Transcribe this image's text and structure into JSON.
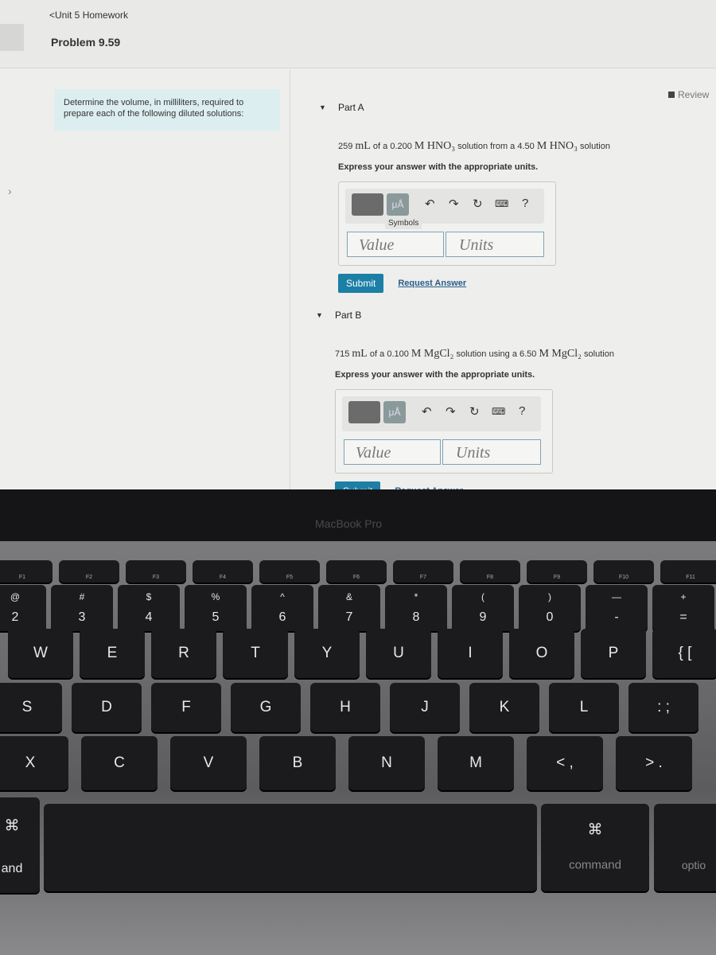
{
  "header": {
    "breadcrumb": "<Unit 5 Homework",
    "problem_title": "Problem 9.59"
  },
  "prompt": "Determine the volume, in milliliters, required to prepare each of the following diluted solutions:",
  "review_label": "Review",
  "parts": [
    {
      "title": "Part A",
      "q_pre": "259 ",
      "q_mL": "mL",
      "q_mid": " of a 0.200 ",
      "q_M1": "M HNO₃",
      "q_mid2": " solution from a 4.50 ",
      "q_M2": "M HNO₃",
      "q_post": " solution",
      "instruction": "Express your answer with the appropriate units.",
      "tooltip": "Symbols",
      "value_placeholder": "Value",
      "units_placeholder": "Units",
      "submit": "Submit",
      "request": "Request Answer",
      "symbols_label": "μÅ"
    },
    {
      "title": "Part B",
      "q_pre": "715 ",
      "q_mL": "mL",
      "q_mid": " of a 0.100 ",
      "q_M1": "M MgCl₂",
      "q_mid2": " solution using a 6.50 ",
      "q_M2": "M MgCl₂",
      "q_post": " solution",
      "instruction": "Express your answer with the appropriate units.",
      "value_placeholder": "Value",
      "units_placeholder": "Units",
      "submit": "Submit",
      "request": "Request Answer",
      "symbols_label": "μÅ"
    }
  ],
  "toolbar_icons": [
    "templates-icon",
    "symbols-icon",
    "undo-icon",
    "redo-icon",
    "reset-icon",
    "keyboard-icon",
    "help-icon"
  ],
  "help_glyph": "?",
  "laptop_brand": "MacBook Pro",
  "keyboard": {
    "fn": [
      "F1",
      "F2",
      "F3",
      "F4",
      "F5",
      "F6",
      "F7",
      "F8",
      "F9",
      "F10",
      "F11"
    ],
    "num": [
      [
        "@",
        "2"
      ],
      [
        "#",
        "3"
      ],
      [
        "$",
        "4"
      ],
      [
        "%",
        "5"
      ],
      [
        "^",
        "6"
      ],
      [
        "&",
        "7"
      ],
      [
        "*",
        "8"
      ],
      [
        "(",
        "9"
      ],
      [
        ")",
        "0"
      ],
      [
        "—",
        "-"
      ],
      [
        "+",
        "="
      ]
    ],
    "row1": [
      "W",
      "E",
      "R",
      "T",
      "Y",
      "U",
      "I",
      "O",
      "P",
      "{ ["
    ],
    "row2": [
      "S",
      "D",
      "F",
      "G",
      "H",
      "J",
      "K",
      "L",
      ": ;"
    ],
    "row3": [
      "X",
      "C",
      "V",
      "B",
      "N",
      "M",
      "< ,",
      "> ."
    ],
    "cmd_symbol": "⌘",
    "left_mod": "and",
    "right_cmd": "command",
    "option": "optio"
  }
}
